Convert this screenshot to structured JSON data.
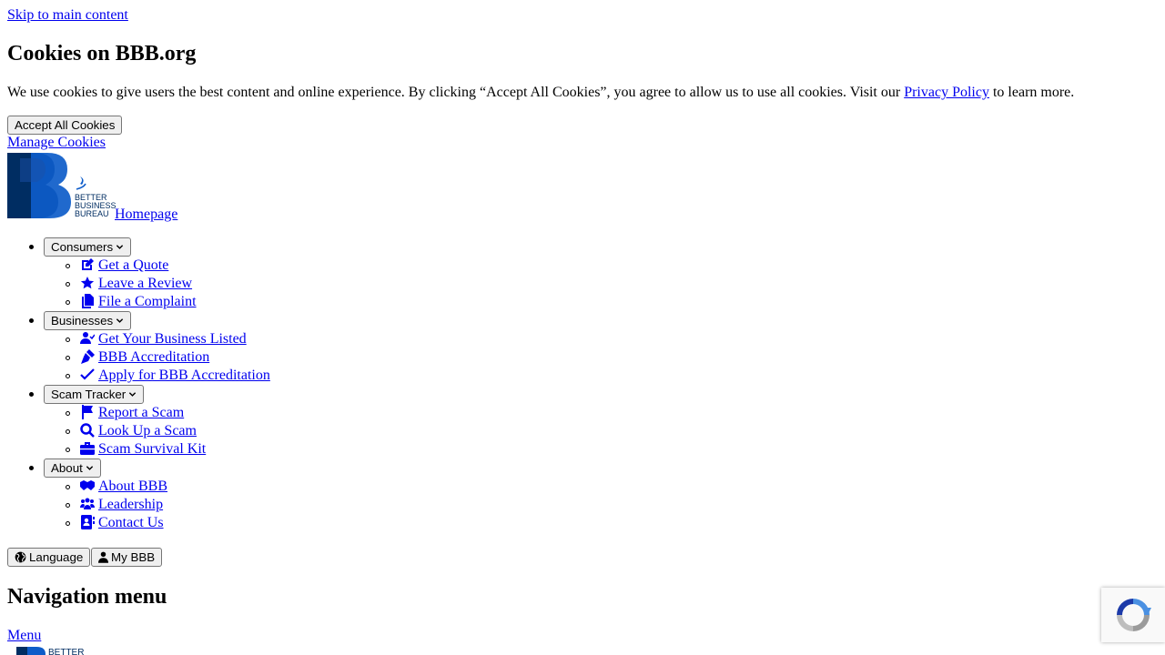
{
  "skip_link": "Skip to main content",
  "cookie": {
    "heading": "Cookies on BBB.org",
    "text_before": "We use cookies to give users the best content and online experience. By clicking “Accept All Cookies”, you agree to allow us to use all cookies. Visit our ",
    "privacy_link": "Privacy Policy",
    "text_after": " to learn more.",
    "accept_button": "Accept All Cookies",
    "manage_link": "Manage Cookies"
  },
  "logo": {
    "line1": "BETTER",
    "line2": "BUSINESS",
    "line3": "BUREAU",
    "homepage_link": " Homepage",
    "brand_blue": "#0d5cc9",
    "brand_navy": "#002d62"
  },
  "nav": {
    "consumers": {
      "label": "Consumers",
      "items": [
        {
          "label": " Get a Quote",
          "icon": "pen-to-square-icon"
        },
        {
          "label": " Leave a Review",
          "icon": "star-icon"
        },
        {
          "label": " File a Complaint",
          "icon": "copy-icon"
        }
      ]
    },
    "businesses": {
      "label": "Businesses",
      "items": [
        {
          "label": " Get Your Business Listed",
          "icon": "user-check-icon"
        },
        {
          "label": " BBB Accreditation",
          "icon": "pen-nib-icon"
        },
        {
          "label": " Apply for BBB Accreditation",
          "icon": "check-icon"
        }
      ]
    },
    "scam_tracker": {
      "label": "Scam Tracker",
      "items": [
        {
          "label": " Report a Scam",
          "icon": "flag-icon"
        },
        {
          "label": " Look Up a Scam",
          "icon": "magnifying-glass-icon"
        },
        {
          "label": " Scam Survival Kit",
          "icon": "briefcase-icon"
        }
      ]
    },
    "about": {
      "label": "About",
      "items": [
        {
          "label": " About BBB",
          "icon": "handshake-icon"
        },
        {
          "label": " Leadership",
          "icon": "users-icon"
        },
        {
          "label": " Contact Us",
          "icon": "address-book-icon"
        }
      ]
    }
  },
  "utility": {
    "language": "Language",
    "my_bbb": "My BBB"
  },
  "nav_menu_heading": "Navigation menu",
  "menu_link": "Menu",
  "bottom_logo_text": "BETTER"
}
